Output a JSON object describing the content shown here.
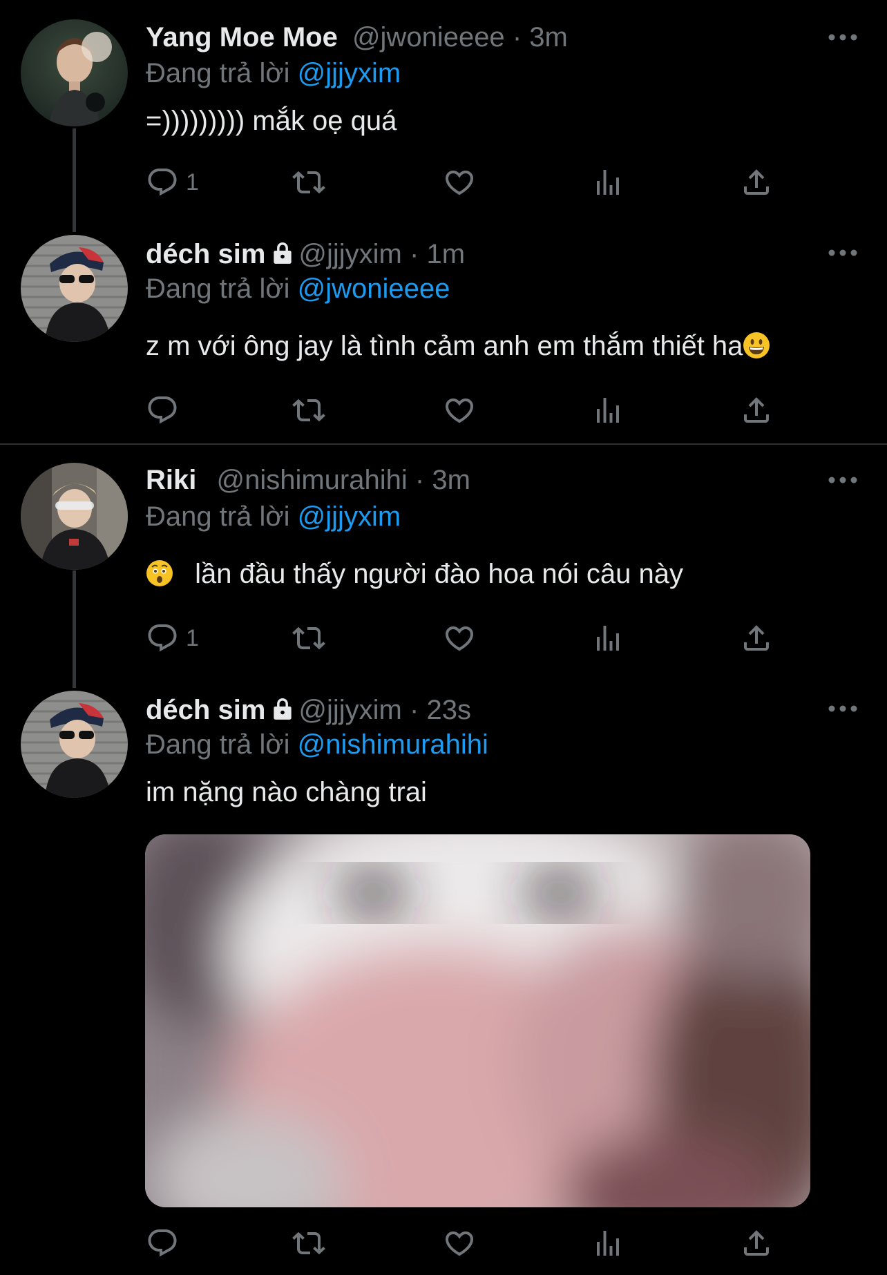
{
  "colors": {
    "background": "#000000",
    "text": "#e7e9ea",
    "secondary": "#71767b",
    "link": "#1d9bf0",
    "divider": "#2f3336"
  },
  "replying_label": "Đang trả lời",
  "tweets": [
    {
      "name": "Yang Moe Moe",
      "handle": "@jwonieeee",
      "time": "3m",
      "locked": false,
      "reply_to": "@jjjyxim",
      "text": "=))))))))) mắk oẹ quá",
      "reply_count": "1"
    },
    {
      "name": "déch sim",
      "handle": "@jjjyxim",
      "time": "1m",
      "locked": true,
      "reply_to": "@jwonieeee",
      "text": "z m với ông jay là tình cảm anh em thắm thiết ha",
      "emoji": "grinning-face",
      "reply_count": ""
    },
    {
      "name": "Riki",
      "handle": "@nishimurahihi",
      "time": "3m",
      "locked": false,
      "reply_to": "@jjjyxim",
      "emoji": "astonished-face",
      "text": "lần đầu thấy người đào hoa nói câu này",
      "reply_count": "1"
    },
    {
      "name": "déch sim",
      "handle": "@jjjyxim",
      "time": "23s",
      "locked": true,
      "reply_to": "@nishimurahihi",
      "text": "im nặng nào chàng trai",
      "has_media": true,
      "reply_count": ""
    }
  ],
  "icons": [
    "reply-icon",
    "retweet-icon",
    "like-icon",
    "analytics-icon",
    "share-icon",
    "more-icon",
    "lock-icon"
  ]
}
